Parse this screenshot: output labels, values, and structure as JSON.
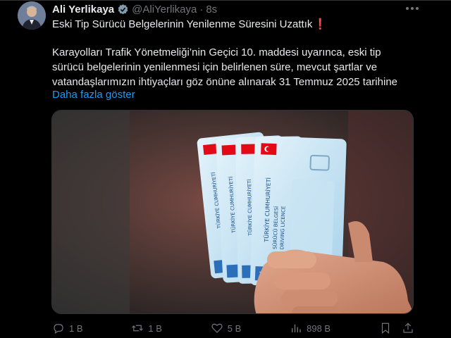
{
  "author": {
    "name": "Ali Yerlikaya",
    "handle": "@AliYerlikaya",
    "separator": "·",
    "time": "8s"
  },
  "tweet": {
    "title": "Eski Tip Sürücü Belgelerinin Yenilenme Süresini Uzattık",
    "title_emoji": "❗",
    "body_lines": [
      "Karayolları Trafik Yönetmeliği’nin Geçici 10. maddesi uyarınca, eski tip",
      "sürücü belgelerinin yenilenmesi için belirlenen süre, mevcut şartlar ve",
      "vatandaşlarımızın ihtiyaçları göz önüne alınarak 31 Temmuz 2025 tarihine"
    ],
    "show_more": "Daha fazla göster"
  },
  "media": {
    "card_labels": [
      "TÜRKİYE CUMHURİYETİ",
      "SÜRÜCÜ BELGESİ",
      "DRIVING LICENCE",
      "TR"
    ]
  },
  "actions": {
    "reply": "1 B",
    "retweet": "1 B",
    "like": "5 B",
    "views": "898 B"
  },
  "colors": {
    "background": "#000000",
    "text": "#e7e9ea",
    "muted": "#71767b",
    "link": "#1d9bf0",
    "accent_red": "#f4212e"
  }
}
